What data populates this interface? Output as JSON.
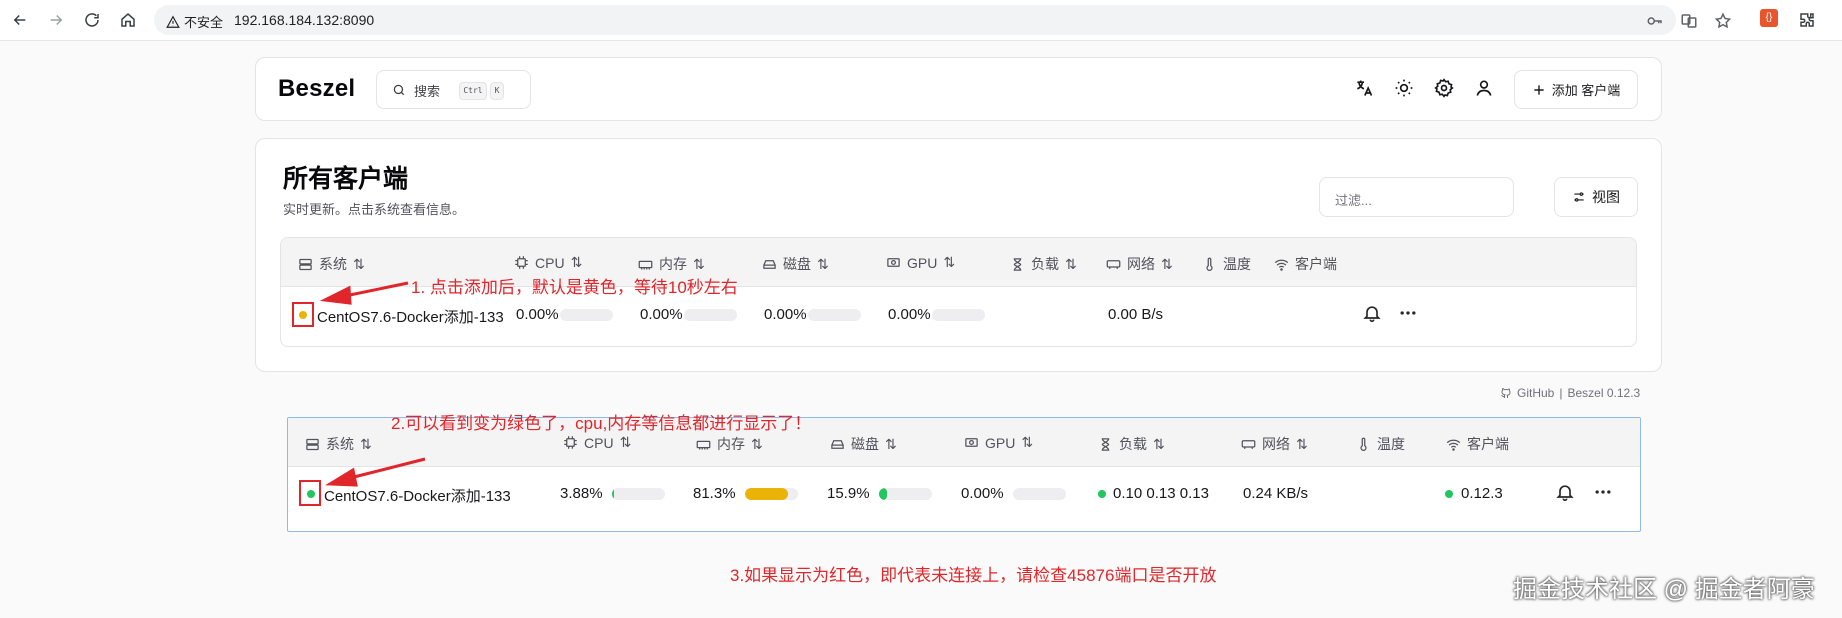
{
  "browser": {
    "warning": "不安全",
    "url": "192.168.184.132:8090"
  },
  "app": {
    "logo": "Beszel",
    "search_label": "搜索",
    "kbd_ctrl": "Ctrl",
    "kbd_k": "K",
    "add_client": "添加 客户端"
  },
  "page": {
    "title": "所有客户端",
    "subtitle": "实时更新。点击系统查看信息。",
    "filter_placeholder": "过滤...",
    "view_label": "视图"
  },
  "columns": [
    "系统",
    "CPU",
    "内存",
    "磁盘",
    "GPU",
    "负载",
    "网络",
    "温度",
    "客户端"
  ],
  "rows": [
    {
      "name": "CentOS7.6-Docker添加-133",
      "status_color": "#eab308",
      "cpu": "0.00%",
      "cpu_level": 0,
      "mem": "0.00%",
      "mem_level": 0,
      "disk": "0.00%",
      "disk_level": 0,
      "gpu": "0.00%",
      "gpu_level": 0,
      "load": "",
      "net": "0.00 B/s",
      "client": ""
    },
    {
      "name": "CentOS7.6-Docker添加-133",
      "status_color": "#22c55e",
      "cpu": "3.88%",
      "cpu_level": 3.88,
      "mem": "81.3%",
      "mem_level": 81.3,
      "disk": "15.9%",
      "disk_level": 15.9,
      "gpu": "0.00%",
      "gpu_level": 0,
      "load": "0.10 0.13 0.13",
      "net": "0.24 KB/s",
      "client": "0.12.3"
    }
  ],
  "footer": {
    "github": "GitHub",
    "sep": "|",
    "version": "Beszel 0.12.3"
  },
  "annotations": {
    "a1": "1. 点击添加后，默认是黄色，等待10秒左右",
    "a2": "2.可以看到变为绿色了，cpu,内存等信息都进行显示了！",
    "a3": "3.如果显示为红色，即代表未连接上，请检查45876端口是否开放"
  },
  "watermark": "掘金技术社区 @ 掘金者阿豪",
  "colors": {
    "accent_red": "#e0262b",
    "status_yellow": "#eab308",
    "status_green": "#22c55e",
    "mem_bar": "#eab308",
    "cpu_bar": "#22c55e"
  }
}
